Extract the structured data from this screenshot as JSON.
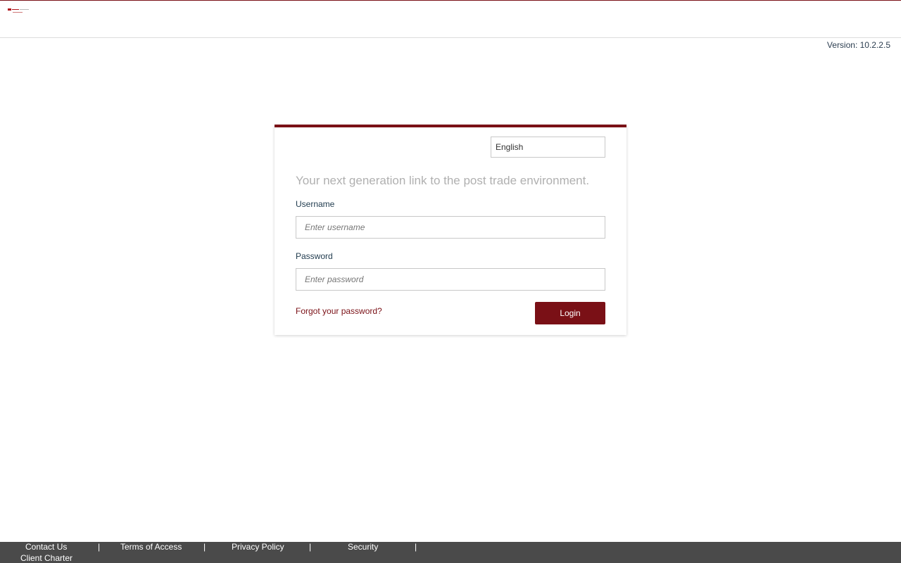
{
  "header": {
    "version_text": "Version: 10.2.2.5"
  },
  "login": {
    "language": "English",
    "tagline": "Your next generation link to the post trade environment.",
    "username_label": "Username",
    "username_placeholder": "Enter username",
    "password_label": "Password",
    "password_placeholder": "Enter password",
    "forgot_link": "Forgot your password?",
    "login_button": "Login"
  },
  "footer": {
    "links": [
      "Contact Us",
      "Terms of Access",
      "Privacy Policy",
      "Security",
      "Client Charter"
    ],
    "separator": "|"
  },
  "colors": {
    "accent": "#7a1016",
    "footer_bg": "#4a4a4a"
  }
}
